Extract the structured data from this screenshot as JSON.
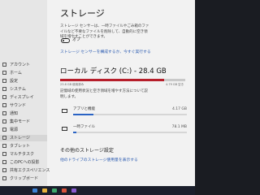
{
  "sidebar": {
    "items": [
      {
        "label": "アカウント"
      },
      {
        "label": "ホーム"
      },
      {
        "label": "設定"
      },
      {
        "label": "システム"
      },
      {
        "label": "ディスプレイ"
      },
      {
        "label": "サウンド"
      },
      {
        "label": "通知"
      },
      {
        "label": "集中モード"
      },
      {
        "label": "電源"
      },
      {
        "label": "ストレージ"
      },
      {
        "label": "タブレット"
      },
      {
        "label": "マルチタスク"
      },
      {
        "label": "このPCへの投影"
      },
      {
        "label": "共有エクスペリエンス"
      },
      {
        "label": "クリップボード"
      },
      {
        "label": "リモート デスクトップ"
      },
      {
        "label": "バージョン情報"
      }
    ]
  },
  "main": {
    "title": "ストレージ",
    "storage_sense_desc": "ストレージ センサーは、一時ファイルやごみ箱のファイルなど不要なファイルを削除して、自動的に空き領域を増やすことができます。",
    "toggle_state": "オフ",
    "storage_sense_link": "ストレージ センサーを構成するか、今すぐ実行する",
    "drive_heading": "ローカル ディスク (C:) - 28.4 GB",
    "used_label": "23.6 GB 使用済み",
    "free_label": "4.79 GB 空き",
    "used_fraction": 0.83,
    "usage_desc": "記憶域の使用状況と空き領域を増やす方法について説明します。",
    "categories": [
      {
        "label": "アプリと機能",
        "size": "4.17 GB",
        "fraction": 0.18
      },
      {
        "label": "一時ファイル",
        "size": "78.1 MB",
        "fraction": 0.03
      }
    ],
    "other_heading": "その他のストレージ設定",
    "other_link": "他のドライブのストレージ使用量を表示する"
  },
  "taskbar": {
    "icon_colors": [
      "#3b82d6",
      "#e8b23a",
      "#3ea86b",
      "#d9533b",
      "#8a5bd1"
    ]
  }
}
